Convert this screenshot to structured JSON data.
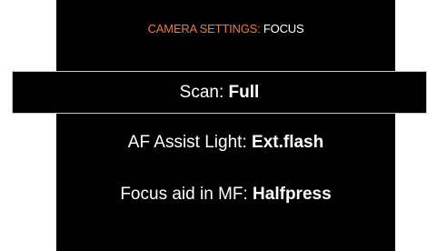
{
  "header": {
    "section": "CAMERA SETTINGS:",
    "subsection": "FOCUS"
  },
  "menu": {
    "items": [
      {
        "label": "Scan:",
        "value": "Full",
        "selected": true
      },
      {
        "label": "AF Assist Light:",
        "value": "Ext.flash",
        "selected": false
      },
      {
        "label": "Focus aid in MF:",
        "value": "Halfpress",
        "selected": false
      }
    ]
  },
  "colors": {
    "background": "#000000",
    "accent": "#f07830",
    "text": "#ffffff",
    "selection_border": "#c8c8c8"
  }
}
